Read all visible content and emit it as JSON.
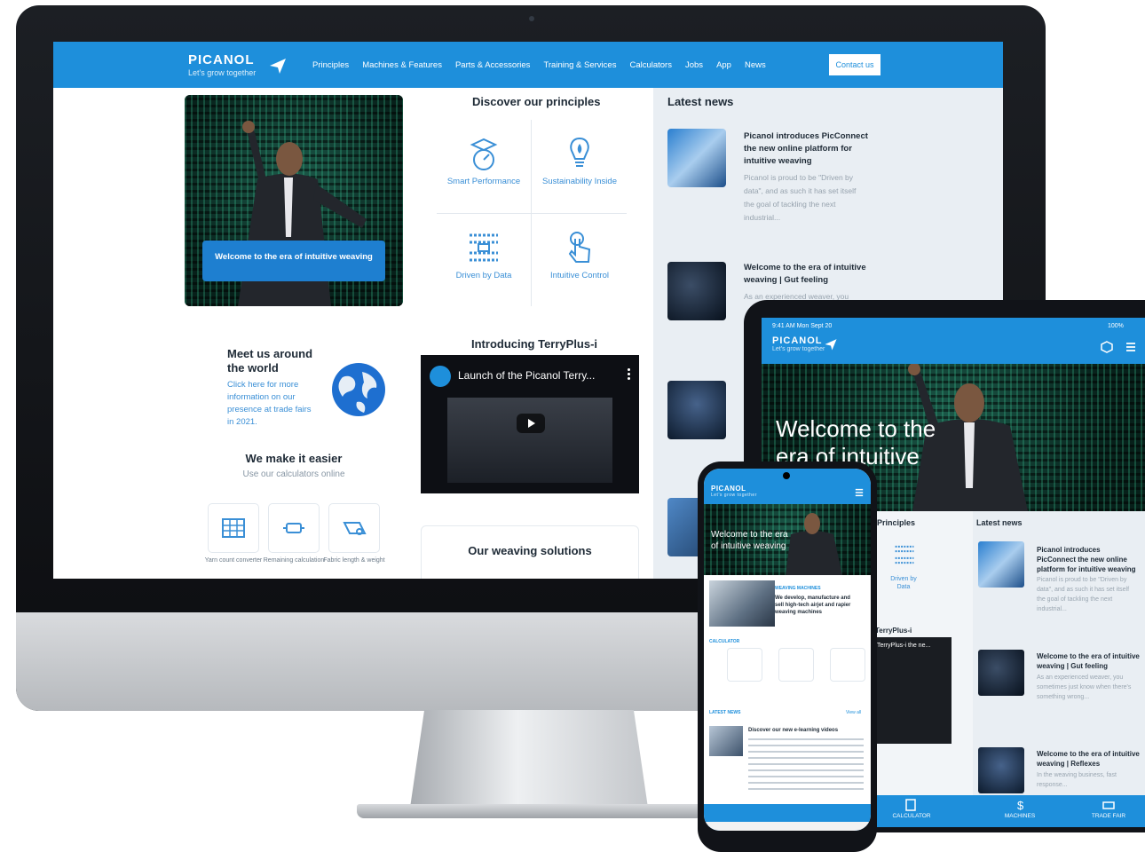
{
  "desktop": {
    "logo": {
      "word": "PICANOL",
      "tagline": "Let's grow together"
    },
    "nav": [
      "Principles",
      "Machines & Features",
      "Parts & Accessories",
      "Training & Services",
      "Calculators",
      "Jobs",
      "App",
      "News"
    ],
    "contact_label": "Contact us",
    "hero_banner": "Welcome to the era of intuitive weaving",
    "principles": {
      "title": "Discover our principles",
      "items": [
        "Smart Performance",
        "Sustainability Inside",
        "Driven by Data",
        "Intuitive Control"
      ]
    },
    "meet": {
      "title": "Meet us around the world",
      "text": "Click here for more information on our presence at trade fairs in 2021."
    },
    "easier": {
      "title": "We make it easier",
      "subtitle": "Use our calculators online",
      "calculators": [
        "Yarn count converter",
        "Remaining calculation",
        "Fabric length & weight"
      ]
    },
    "video": {
      "section_title": "Introducing TerryPlus-i",
      "title": "Launch of the Picanol Terry..."
    },
    "solutions_title": "Our weaving solutions",
    "news": {
      "title": "Latest news",
      "items": [
        {
          "title": "Picanol introduces PicConnect the new online platform for intuitive weaving",
          "text": "Picanol is proud to be \"Driven by data\", and as such it has set itself the goal of tackling the next industrial..."
        },
        {
          "title": "Welcome to the era of intuitive weaving | Gut feeling",
          "text": "As an experienced weaver, you"
        }
      ]
    }
  },
  "tablet": {
    "status_time": "9:41 AM  Mon Sept 20",
    "status_battery": "100%",
    "logo": {
      "word": "PICANOL",
      "tagline": "Let's grow together"
    },
    "hero_text": "Welcome to the era of intuitive weaving",
    "principles_label": "Principles",
    "data_label": "Driven by Data",
    "terry_label": "TerryPlus-i",
    "video_title": "TerryPlus-i the ne...",
    "news_title": "Latest news",
    "news": [
      {
        "title": "Picanol introduces PicConnect the new online platform for intuitive weaving",
        "text": "Picanol is proud to be \"Driven by data\", and as such it has set itself the goal of tackling the next industrial..."
      },
      {
        "title": "Welcome to the era of intuitive weaving | Gut feeling",
        "text": "As an experienced weaver, you sometimes just know when there's something wrong..."
      },
      {
        "title": "Welcome to the era of intuitive weaving | Reflexes",
        "text": "In the weaving business, fast response..."
      }
    ],
    "footer": [
      "CALCULATOR",
      "MACHINES",
      "TRADE FAIR"
    ]
  },
  "phone": {
    "logo": {
      "word": "PICANOL",
      "tagline": "Let's grow together"
    },
    "hero_text": "Welcome to the era of intuitive weaving",
    "weaving_label": "WEAVING MACHINES",
    "weaving_text": "We develop, manufacture and sell high-tech airjet and rapier weaving machines",
    "calculator_label": "CALCULATOR",
    "news_label": "LATEST NEWS",
    "view_all": "View all",
    "news_title": "Discover our new e-learning videos"
  },
  "colors": {
    "brand_blue": "#1e8fdb",
    "text_dark": "#1e2a36",
    "link_blue": "#3a8fd6",
    "news_bg": "#e9eef3"
  }
}
